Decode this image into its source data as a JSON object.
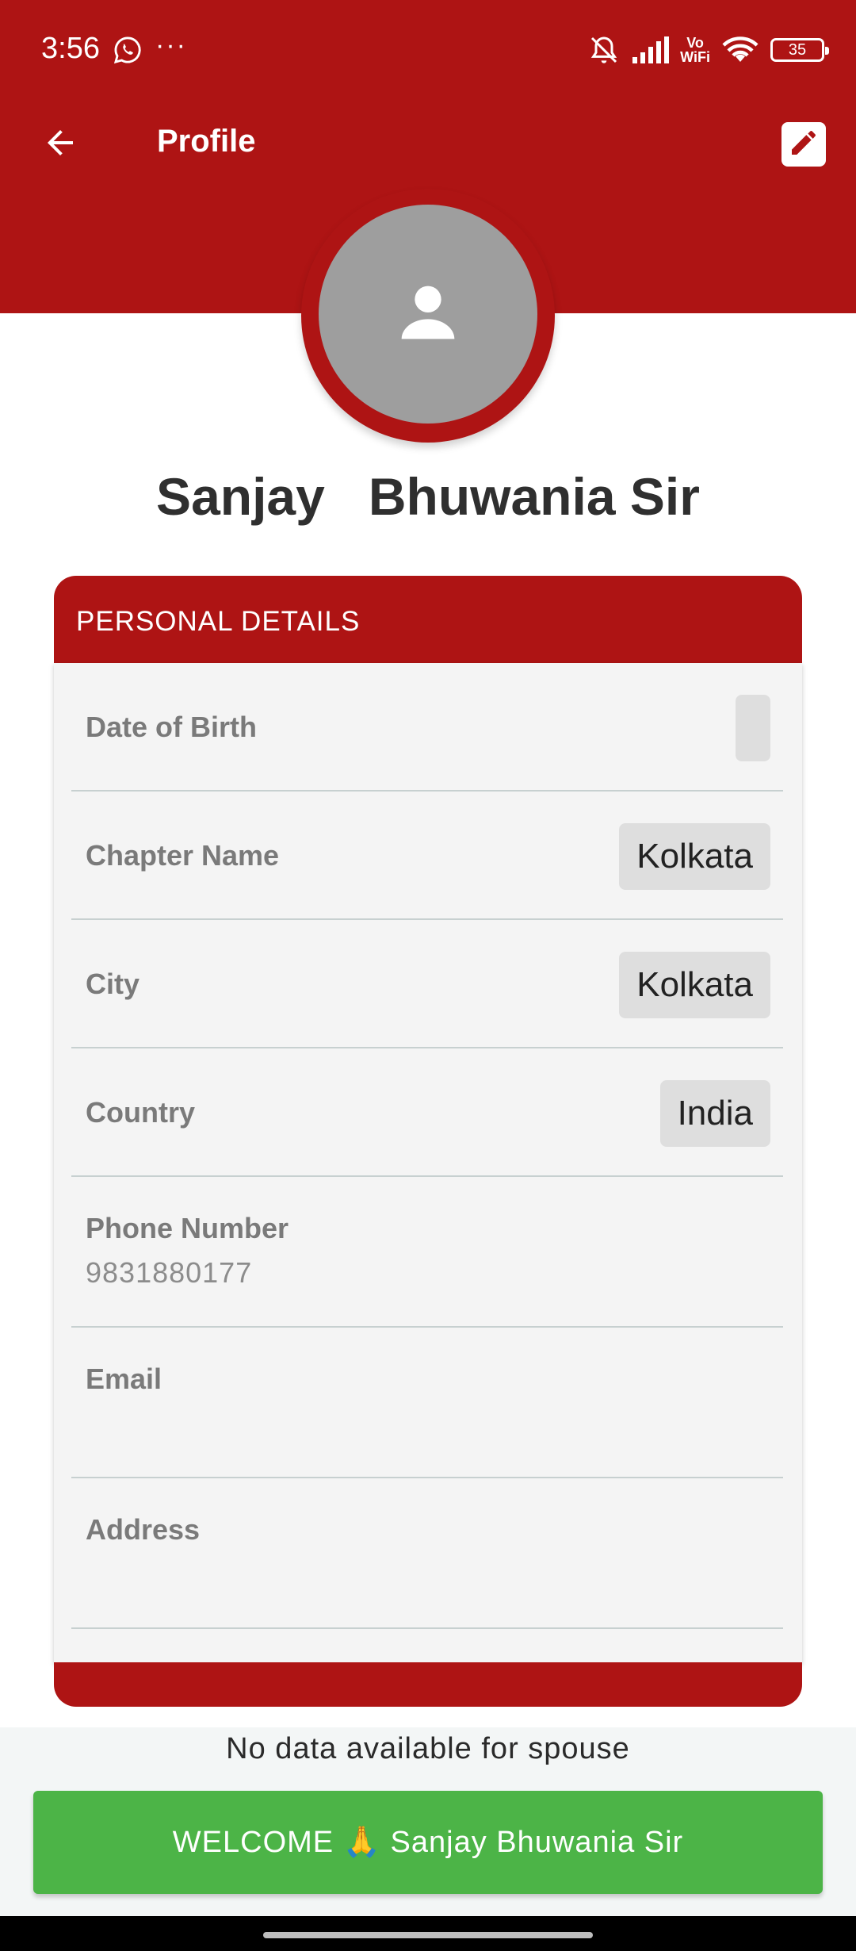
{
  "status_bar": {
    "time": "3:56",
    "overflow": "···",
    "vowifi_line1": "Vo",
    "vowifi_line2": "WiFi",
    "battery": "35",
    "icons": [
      "whatsapp-icon",
      "mute-icon",
      "signal-icon",
      "wifi-icon",
      "battery-icon"
    ]
  },
  "app_bar": {
    "title": "Profile",
    "back_icon": "arrow-back-icon",
    "edit_icon": "edit-icon"
  },
  "profile": {
    "name": "Sanjay   Bhuwania Sir",
    "avatar_icon": "person-icon"
  },
  "personal_details": {
    "title": "PERSONAL DETAILS",
    "date_of_birth": {
      "label": "Date of Birth",
      "value": ""
    },
    "chapter_name": {
      "label": "Chapter Name",
      "value": "Kolkata"
    },
    "city": {
      "label": "City",
      "value": "Kolkata"
    },
    "country": {
      "label": "Country",
      "value": "India"
    },
    "phone": {
      "label": "Phone Number",
      "value": "9831880177"
    },
    "email": {
      "label": "Email",
      "value": ""
    },
    "address": {
      "label": "Address",
      "value": ""
    }
  },
  "spouse_note": "No data available for spouse",
  "welcome_button": "WELCOME 🙏 Sanjay Bhuwania Sir",
  "colors": {
    "primary_red": "#AE1414",
    "welcome_green": "#4CB447",
    "avatar_gray": "#9E9E9E",
    "card_bg": "#F4F4F4"
  }
}
